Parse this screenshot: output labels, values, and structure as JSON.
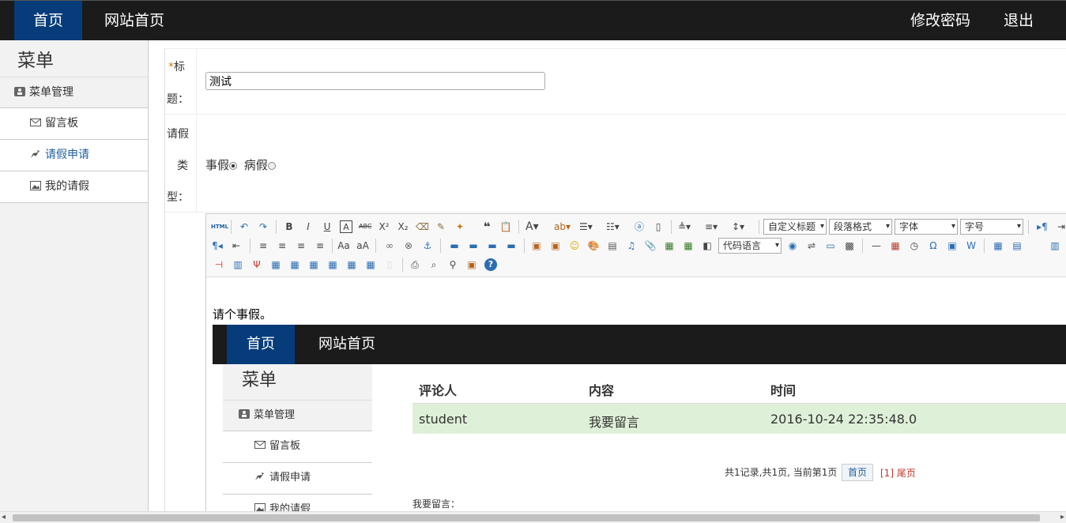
{
  "topbar": {
    "home": "首页",
    "site_home": "网站首页",
    "change_password": "修改密码",
    "logout": "退出"
  },
  "sidebar": {
    "title": "菜单",
    "group": "菜单管理",
    "items": [
      {
        "label": "留言板",
        "icon": "envelope-icon"
      },
      {
        "label": "请假申请",
        "icon": "plug-icon"
      },
      {
        "label": "我的请假",
        "icon": "image-icon"
      }
    ],
    "active_item": "请假申请"
  },
  "form": {
    "title_label_req": "*",
    "title_label_1": "标",
    "title_label_2": "题：",
    "title_value": "测试",
    "type_label_1": "请假",
    "type_label_2": "类",
    "type_label_3": "型：",
    "type_options": [
      "事假",
      "病假"
    ],
    "type_selected": "事假"
  },
  "editor": {
    "selects": {
      "custom_heading": "自定义标题",
      "paragraph": "段落格式",
      "font_family": "字体",
      "font_size": "字号",
      "code_language": "代码语言"
    },
    "content_text": "请个事假。",
    "embedded": {
      "nav_home": "首页",
      "nav_site": "网站首页",
      "menu_title": "菜单",
      "menu_group": "菜单管理",
      "menu_items": [
        "留言板",
        "请假申请",
        "我的请假"
      ],
      "table_headers": [
        "评论人",
        "内容",
        "时间"
      ],
      "table_rows": [
        [
          "student",
          "我要留言",
          "2016-10-24 22:35:48.0"
        ]
      ],
      "pager_text": "共1记录,共1页, 当前第1页",
      "pager_first": "首页",
      "pager_last": "[1] 尾页",
      "message_label": "我要留言："
    }
  }
}
